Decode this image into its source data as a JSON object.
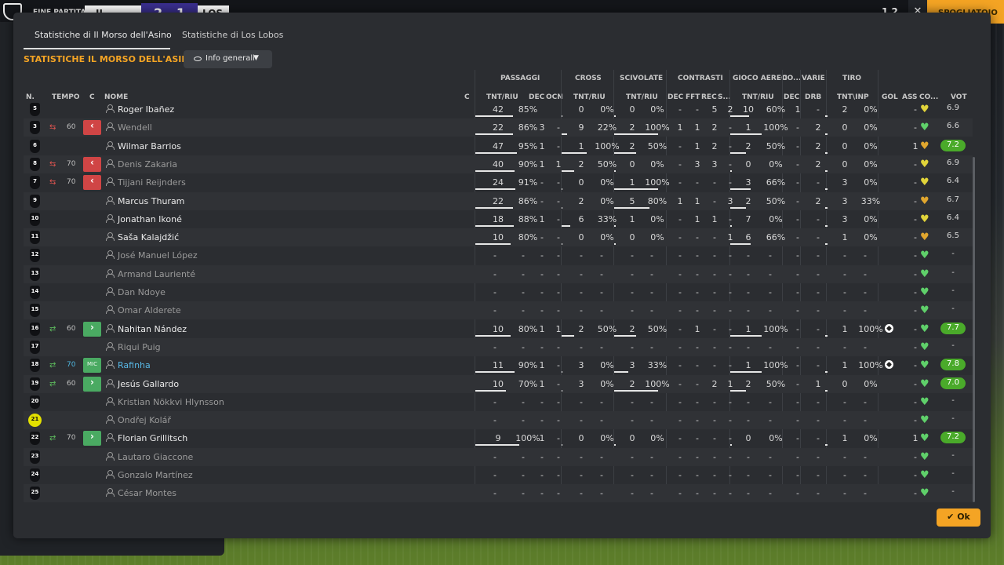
{
  "topbar": {
    "status": "FINE PARTITA",
    "home_short": "IL MOR",
    "score": "2 - 1",
    "away_short": "LOS LO",
    "right_num": "1 2",
    "continue": "SPOGLIATOIO",
    "close": "✕"
  },
  "tabs": [
    "Statistiche di Il Morso dell'Asino",
    "Statistiche di Los Lobos"
  ],
  "title": "STATISTICHE IL MORSO DELL'ASINO",
  "dropdown": "Info generali",
  "ok": "Ok",
  "colors": {
    "accent": "#f4a424",
    "sub_out": "#d04545",
    "sub_in": "#4aaa62",
    "rating_bg": "#4aaa2a",
    "heart_green": "#5fd06a",
    "heart_yellow": "#e1d43a",
    "heart_orange": "#e0a62e"
  },
  "headers": {
    "groups": [
      "PASSAGGI",
      "CROSS",
      "SCIVOLATE",
      "CONTRASTI",
      "GIOCO AEREO",
      "CO...",
      "VARIE",
      "TIRO"
    ],
    "cols": [
      "N.",
      "TEMPO",
      "C",
      "NOME",
      "C",
      "TNT/RIU",
      "DEC",
      "OCN",
      "TNT/RIU",
      "TNT/RIU",
      "DEC",
      "FFT",
      "REC",
      "S...",
      "TNT/RIU",
      "DEC",
      "DRB",
      "TNT\\INP",
      "GOL",
      "ASS",
      "CO...",
      "VOT"
    ]
  },
  "players": [
    {
      "num": "5",
      "sub": "",
      "min": "",
      "pos": "",
      "name": "Roger Ibañez",
      "dim": false,
      "pass": [
        "42",
        "85%"
      ],
      "pass_pct": 85,
      "pdec": "",
      "pocn": "",
      "cross": [
        "0",
        "0%"
      ],
      "cross_pct": 0,
      "tack": [
        "0",
        "0%"
      ],
      "tack_pct": 0,
      "cdec": "-",
      "cfft": "-",
      "crec": "5",
      "cs": "2",
      "air": [
        "10",
        "60%"
      ],
      "air_pct": 60,
      "codec": "1",
      "drb": "-",
      "shot": [
        "2",
        "0%"
      ],
      "gol": "",
      "ass": "-",
      "heart": "yellow",
      "vot": "6.9"
    },
    {
      "num": "3",
      "sub": "out",
      "min": "60",
      "pos": "out",
      "name": "Wendell",
      "dim": true,
      "pass": [
        "22",
        "86%"
      ],
      "pass_pct": 86,
      "pdec": "3",
      "pocn": "-",
      "cross": [
        "9",
        "22%"
      ],
      "cross_pct": 22,
      "tack": [
        "2",
        "100%"
      ],
      "tack_pct": 100,
      "cdec": "1",
      "cfft": "1",
      "crec": "2",
      "cs": "-",
      "air": [
        "1",
        "100%"
      ],
      "air_pct": 100,
      "codec": "-",
      "drb": "2",
      "shot": [
        "0",
        "0%"
      ],
      "gol": "",
      "ass": "-",
      "heart": "green",
      "vot": "6.6"
    },
    {
      "num": "6",
      "sub": "",
      "min": "",
      "pos": "",
      "name": "Wilmar Barrios",
      "dim": false,
      "pass": [
        "47",
        "95%"
      ],
      "pass_pct": 95,
      "pdec": "1",
      "pocn": "-",
      "cross": [
        "1",
        "100%"
      ],
      "cross_pct": 100,
      "tack": [
        "2",
        "50%"
      ],
      "tack_pct": 50,
      "cdec": "-",
      "cfft": "1",
      "crec": "2",
      "cs": "-",
      "air": [
        "2",
        "50%"
      ],
      "air_pct": 50,
      "codec": "-",
      "drb": "2",
      "shot": [
        "0",
        "0%"
      ],
      "gol": "",
      "ass": "1",
      "heart": "orange",
      "vot": "7.2"
    },
    {
      "num": "8",
      "sub": "out",
      "min": "70",
      "pos": "out",
      "name": "Denis Zakaria",
      "dim": true,
      "pass": [
        "40",
        "90%"
      ],
      "pass_pct": 90,
      "pdec": "1",
      "pocn": "1",
      "cross": [
        "2",
        "50%"
      ],
      "cross_pct": 50,
      "tack": [
        "0",
        "0%"
      ],
      "tack_pct": 0,
      "cdec": "-",
      "cfft": "3",
      "crec": "3",
      "cs": "-",
      "air": [
        "0",
        "0%"
      ],
      "air_pct": 0,
      "codec": "-",
      "drb": "2",
      "shot": [
        "0",
        "0%"
      ],
      "gol": "",
      "ass": "-",
      "heart": "yellow",
      "vot": "6.9"
    },
    {
      "num": "7",
      "sub": "out",
      "min": "70",
      "pos": "out",
      "name": "Tijjani Reijnders",
      "dim": true,
      "pass": [
        "24",
        "91%"
      ],
      "pass_pct": 91,
      "pdec": "-",
      "pocn": "-",
      "cross": [
        "0",
        "0%"
      ],
      "cross_pct": 0,
      "tack": [
        "1",
        "100%"
      ],
      "tack_pct": 100,
      "cdec": "-",
      "cfft": "-",
      "crec": "-",
      "cs": "-",
      "air": [
        "3",
        "66%"
      ],
      "air_pct": 66,
      "codec": "-",
      "drb": "-",
      "shot": [
        "3",
        "0%"
      ],
      "gol": "",
      "ass": "-",
      "heart": "yellow",
      "vot": "6.4"
    },
    {
      "num": "9",
      "sub": "",
      "min": "",
      "pos": "",
      "name": "Marcus Thuram",
      "dim": false,
      "pass": [
        "22",
        "86%"
      ],
      "pass_pct": 86,
      "pdec": "-",
      "pocn": "-",
      "cross": [
        "2",
        "0%"
      ],
      "cross_pct": 0,
      "tack": [
        "5",
        "80%"
      ],
      "tack_pct": 80,
      "cdec": "1",
      "cfft": "1",
      "crec": "-",
      "cs": "3",
      "air": [
        "2",
        "50%"
      ],
      "air_pct": 50,
      "codec": "-",
      "drb": "2",
      "shot": [
        "3",
        "33%"
      ],
      "gol": "",
      "ass": "-",
      "heart": "orange",
      "vot": "6.7"
    },
    {
      "num": "10",
      "sub": "",
      "min": "",
      "pos": "",
      "name": "Jonathan Ikoné",
      "dim": false,
      "pass": [
        "18",
        "88%"
      ],
      "pass_pct": 88,
      "pdec": "1",
      "pocn": "-",
      "cross": [
        "6",
        "33%"
      ],
      "cross_pct": 33,
      "tack": [
        "1",
        "0%"
      ],
      "tack_pct": 0,
      "cdec": "-",
      "cfft": "1",
      "crec": "1",
      "cs": "-",
      "air": [
        "7",
        "0%"
      ],
      "air_pct": 0,
      "codec": "-",
      "drb": "-",
      "shot": [
        "3",
        "0%"
      ],
      "gol": "",
      "ass": "-",
      "heart": "yellow",
      "vot": "6.4"
    },
    {
      "num": "11",
      "sub": "",
      "min": "",
      "pos": "",
      "name": "Saša Kalajdžić",
      "dim": false,
      "pass": [
        "10",
        "80%"
      ],
      "pass_pct": 80,
      "pdec": "-",
      "pocn": "-",
      "cross": [
        "0",
        "0%"
      ],
      "cross_pct": 0,
      "tack": [
        "0",
        "0%"
      ],
      "tack_pct": 0,
      "cdec": "-",
      "cfft": "-",
      "crec": "-",
      "cs": "1",
      "air": [
        "6",
        "66%"
      ],
      "air_pct": 66,
      "codec": "-",
      "drb": "-",
      "shot": [
        "1",
        "0%"
      ],
      "gol": "",
      "ass": "-",
      "heart": "orange",
      "vot": "6.5"
    },
    {
      "num": "12",
      "sub": "",
      "min": "",
      "pos": "",
      "name": "José Manuel López",
      "dim": true,
      "empty": true,
      "heart": "green"
    },
    {
      "num": "13",
      "sub": "",
      "min": "",
      "pos": "",
      "name": "Armand Laurienté",
      "dim": true,
      "empty": true,
      "heart": "green"
    },
    {
      "num": "14",
      "sub": "",
      "min": "",
      "pos": "",
      "name": "Dan Ndoye",
      "dim": true,
      "empty": true,
      "heart": "green"
    },
    {
      "num": "15",
      "sub": "",
      "min": "",
      "pos": "",
      "name": "Omar Alderete",
      "dim": true,
      "empty": true,
      "heart": "green"
    },
    {
      "num": "16",
      "sub": "in",
      "min": "60",
      "pos": "in",
      "name": "Nahitan Nández",
      "dim": false,
      "pass": [
        "10",
        "80%"
      ],
      "pass_pct": 80,
      "pdec": "1",
      "pocn": "1",
      "cross": [
        "2",
        "50%"
      ],
      "cross_pct": 50,
      "tack": [
        "2",
        "50%"
      ],
      "tack_pct": 50,
      "cdec": "-",
      "cfft": "1",
      "crec": "-",
      "cs": "-",
      "air": [
        "1",
        "100%"
      ],
      "air_pct": 100,
      "codec": "-",
      "drb": "-",
      "shot": [
        "1",
        "100%"
      ],
      "gol": "ball",
      "ass": "-",
      "heart": "green",
      "vot": "7.7"
    },
    {
      "num": "17",
      "sub": "",
      "min": "",
      "pos": "",
      "name": "Riqui Puig",
      "dim": true,
      "empty": true,
      "heart": "green"
    },
    {
      "num": "18",
      "sub": "in",
      "min": "70",
      "pos": "mic",
      "pos_label": "MIC",
      "name": "Rafinha",
      "hl": true,
      "dim": false,
      "pass": [
        "11",
        "90%"
      ],
      "pass_pct": 90,
      "pdec": "1",
      "pocn": "-",
      "cross": [
        "3",
        "0%"
      ],
      "cross_pct": 0,
      "tack": [
        "3",
        "33%"
      ],
      "tack_pct": 33,
      "cdec": "-",
      "cfft": "-",
      "crec": "-",
      "cs": "-",
      "air": [
        "1",
        "100%"
      ],
      "air_pct": 100,
      "codec": "-",
      "drb": "-",
      "shot": [
        "1",
        "100%"
      ],
      "gol": "ball",
      "ass": "-",
      "heart": "green",
      "vot": "7.8"
    },
    {
      "num": "19",
      "sub": "in",
      "min": "60",
      "pos": "in",
      "name": "Jesús Gallardo",
      "dim": false,
      "pass": [
        "10",
        "70%"
      ],
      "pass_pct": 70,
      "pdec": "1",
      "pocn": "-",
      "cross": [
        "3",
        "0%"
      ],
      "cross_pct": 0,
      "tack": [
        "2",
        "100%"
      ],
      "tack_pct": 100,
      "cdec": "-",
      "cfft": "-",
      "crec": "2",
      "cs": "1",
      "air": [
        "2",
        "50%"
      ],
      "air_pct": 50,
      "codec": "-",
      "drb": "1",
      "shot": [
        "0",
        "0%"
      ],
      "gol": "",
      "ass": "-",
      "heart": "green",
      "vot": "7.0"
    },
    {
      "num": "20",
      "sub": "",
      "min": "",
      "pos": "",
      "name": "Kristian Nökkvi Hlynsson",
      "dim": true,
      "empty": true,
      "heart": "green"
    },
    {
      "num": "21",
      "gk": true,
      "sub": "",
      "min": "",
      "pos": "",
      "name": "Ondřej Kolář",
      "dim": true,
      "empty": true,
      "heart": "green"
    },
    {
      "num": "22",
      "sub": "in",
      "min": "70",
      "pos": "in",
      "name": "Florian Grillitsch",
      "dim": false,
      "pass": [
        "9",
        "100%"
      ],
      "pass_pct": 100,
      "pdec": "1",
      "pocn": "-",
      "cross": [
        "0",
        "0%"
      ],
      "cross_pct": 0,
      "tack": [
        "0",
        "0%"
      ],
      "tack_pct": 0,
      "cdec": "-",
      "cfft": "-",
      "crec": "-",
      "cs": "-",
      "air": [
        "0",
        "0%"
      ],
      "air_pct": 0,
      "codec": "-",
      "drb": "-",
      "shot": [
        "1",
        "0%"
      ],
      "gol": "",
      "ass": "1",
      "heart": "green",
      "vot": "7.2"
    },
    {
      "num": "23",
      "sub": "",
      "min": "",
      "pos": "",
      "name": "Lautaro Giaccone",
      "dim": true,
      "empty": true,
      "heart": "green"
    },
    {
      "num": "24",
      "sub": "",
      "min": "",
      "pos": "",
      "name": "Gonzalo Martínez",
      "dim": true,
      "empty": true,
      "heart": "green"
    },
    {
      "num": "25",
      "sub": "",
      "min": "",
      "pos": "",
      "name": "César Montes",
      "dim": true,
      "empty": true,
      "heart": "green"
    }
  ]
}
